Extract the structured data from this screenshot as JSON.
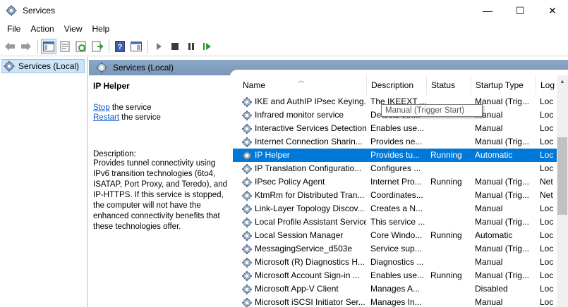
{
  "window": {
    "title": "Services",
    "min_glyph": "—",
    "max_glyph": "☐",
    "close_glyph": "✕"
  },
  "menu": [
    "File",
    "Action",
    "View",
    "Help"
  ],
  "toolbar_icons": [
    "back-icon",
    "forward-icon",
    "show-hide-console-tree-icon",
    "properties-icon",
    "refresh-icon",
    "export-list-icon",
    "help-icon",
    "console-view-icon",
    "start-icon",
    "stop-icon",
    "pause-icon",
    "restart-icon"
  ],
  "tree": {
    "item_label": "Services (Local)"
  },
  "pane": {
    "header_label": "Services (Local)"
  },
  "description": {
    "service_title": "IP Helper",
    "stop_link": "Stop",
    "stop_rest": " the service",
    "restart_link": "Restart",
    "restart_rest": " the service",
    "label": "Description:",
    "text": "Provides tunnel connectivity using IPv6 transition technologies (6to4, ISATAP, Port Proxy, and Teredo), and IP-HTTPS. If this service is stopped, the computer will not have the enhanced connectivity benefits that these technologies offer."
  },
  "columns": [
    "Name",
    "Description",
    "Status",
    "Startup Type",
    "Log"
  ],
  "rows": [
    {
      "name": "IKE and AuthIP IPsec Keying...",
      "description": "The IKEEXT ...",
      "status": "",
      "startup": "Manual (Trig...",
      "log": "Loc"
    },
    {
      "name": "Infrared monitor service",
      "description": "Detects oth...",
      "status": "",
      "startup": "Manual",
      "log": "Loc"
    },
    {
      "name": "Interactive Services Detection",
      "description": "Enables use...",
      "status": "",
      "startup": "Manual",
      "log": "Loc"
    },
    {
      "name": "Internet Connection Sharin...",
      "description": "Provides ne...",
      "status": "",
      "startup": "Manual (Trig...",
      "log": "Loc"
    },
    {
      "name": "IP Helper",
      "description": "Provides tu...",
      "status": "Running",
      "startup": "Automatic",
      "log": "Loc"
    },
    {
      "name": "IP Translation Configuratio...",
      "description": "Configures ...",
      "status": "",
      "startup": "",
      "log": "Loc"
    },
    {
      "name": "IPsec Policy Agent",
      "description": "Internet Pro...",
      "status": "Running",
      "startup": "Manual (Trig...",
      "log": "Net"
    },
    {
      "name": "KtmRm for Distributed Tran...",
      "description": "Coordinates...",
      "status": "",
      "startup": "Manual (Trig...",
      "log": "Net"
    },
    {
      "name": "Link-Layer Topology Discov...",
      "description": "Creates a N...",
      "status": "",
      "startup": "Manual",
      "log": "Loc"
    },
    {
      "name": "Local Profile Assistant Service",
      "description": "This service ...",
      "status": "",
      "startup": "Manual (Trig...",
      "log": "Loc"
    },
    {
      "name": "Local Session Manager",
      "description": "Core Windo...",
      "status": "Running",
      "startup": "Automatic",
      "log": "Loc"
    },
    {
      "name": "MessagingService_d503e",
      "description": "Service sup...",
      "status": "",
      "startup": "Manual (Trig...",
      "log": "Loc"
    },
    {
      "name": "Microsoft (R) Diagnostics H...",
      "description": "Diagnostics ...",
      "status": "",
      "startup": "Manual",
      "log": "Loc"
    },
    {
      "name": "Microsoft Account Sign-in ...",
      "description": "Enables use...",
      "status": "Running",
      "startup": "Manual (Trig...",
      "log": "Loc"
    },
    {
      "name": "Microsoft App-V Client",
      "description": "Manages A...",
      "status": "",
      "startup": "Disabled",
      "log": "Loc"
    },
    {
      "name": "Microsoft iSCSI Initiator Ser...",
      "description": "Manages In...",
      "status": "",
      "startup": "Manual",
      "log": "Loc"
    }
  ],
  "selected_row": 4,
  "tooltip": "Manual (Trigger Start)",
  "colors": {
    "selection": "#0078d7",
    "pane_header": "#8ba7c6",
    "link": "#0a5cc8"
  }
}
